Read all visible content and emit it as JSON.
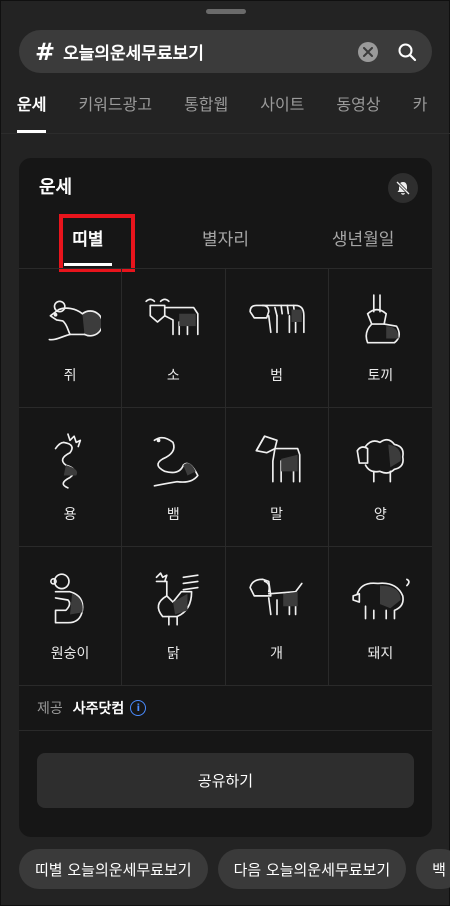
{
  "search": {
    "hash": "#",
    "query": "오늘의운세무료보기"
  },
  "tabs": [
    {
      "label": "운세",
      "active": true
    },
    {
      "label": "키워드광고"
    },
    {
      "label": "통합웹"
    },
    {
      "label": "사이트"
    },
    {
      "label": "동영상"
    },
    {
      "label": "카"
    }
  ],
  "card": {
    "title": "운세",
    "subtabs": [
      {
        "label": "띠별",
        "active": true
      },
      {
        "label": "별자리"
      },
      {
        "label": "생년월일"
      }
    ],
    "zodiac": [
      {
        "label": "쥐",
        "icon": "rat-icon"
      },
      {
        "label": "소",
        "icon": "ox-icon"
      },
      {
        "label": "범",
        "icon": "tiger-icon"
      },
      {
        "label": "토끼",
        "icon": "rabbit-icon"
      },
      {
        "label": "용",
        "icon": "dragon-icon"
      },
      {
        "label": "뱀",
        "icon": "snake-icon"
      },
      {
        "label": "말",
        "icon": "horse-icon"
      },
      {
        "label": "양",
        "icon": "sheep-icon"
      },
      {
        "label": "원숭이",
        "icon": "monkey-icon"
      },
      {
        "label": "닭",
        "icon": "rooster-icon"
      },
      {
        "label": "개",
        "icon": "dog-icon"
      },
      {
        "label": "돼지",
        "icon": "pig-icon"
      }
    ],
    "provider_key": "제공",
    "provider_value": "사주닷컴",
    "info_glyph": "i",
    "share_label": "공유하기"
  },
  "chips": [
    {
      "label": "띠별 오늘의운세무료보기"
    },
    {
      "label": "다음 오늘의운세무료보기"
    },
    {
      "label": "백"
    }
  ],
  "colors": {
    "background": "#232323",
    "card": "#161616",
    "highlight": "#e8141c",
    "accent": "#4a8cff"
  }
}
